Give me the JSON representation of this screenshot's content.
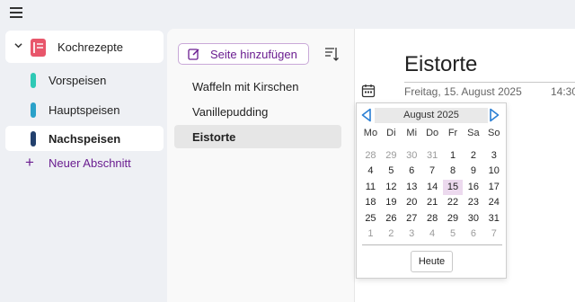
{
  "nav": {
    "notebook": "Kochrezepte",
    "sections": [
      {
        "label": "Vorspeisen",
        "color": "#2ec9b5"
      },
      {
        "label": "Hauptspeisen",
        "color": "#2aa1c9"
      },
      {
        "label": "Nachspeisen",
        "color": "#22406d",
        "active": true
      }
    ],
    "add_section": "Neuer Abschnitt"
  },
  "pages_pane": {
    "add_page": "Seite hinzufügen",
    "pages": [
      {
        "label": "Waffeln mit Kirschen"
      },
      {
        "label": "Vanillepudding"
      },
      {
        "label": "Eistorte",
        "active": true
      }
    ]
  },
  "page": {
    "title": "Eistorte",
    "date": "Freitag, 15. August 2025",
    "time": "14:30"
  },
  "calendar": {
    "month": "August 2025",
    "weekdays": [
      "Mo",
      "Di",
      "Mi",
      "Do",
      "Fr",
      "Sa",
      "So"
    ],
    "weeks": [
      [
        "28",
        "29",
        "30",
        "31",
        "1",
        "2",
        "3"
      ],
      [
        "4",
        "5",
        "6",
        "7",
        "8",
        "9",
        "10"
      ],
      [
        "11",
        "12",
        "13",
        "14",
        "15",
        "16",
        "17"
      ],
      [
        "18",
        "19",
        "20",
        "21",
        "22",
        "23",
        "24"
      ],
      [
        "25",
        "26",
        "27",
        "28",
        "29",
        "30",
        "31"
      ],
      [
        "1",
        "2",
        "3",
        "4",
        "5",
        "6",
        "7"
      ]
    ],
    "selected": "15",
    "today_button": "Heute"
  },
  "colors": {
    "accent": "#6a1d90",
    "notebook": "#e8566b",
    "nav_arrow": "#2a7fd4"
  }
}
